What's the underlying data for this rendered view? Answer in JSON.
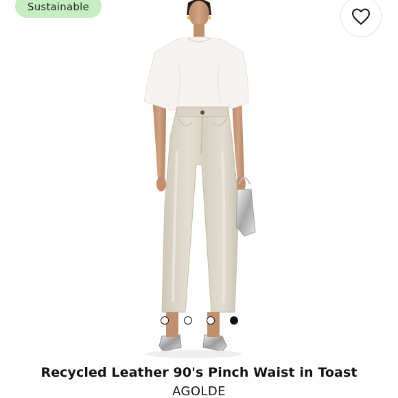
{
  "badge": {
    "label": "Sustainable",
    "color": "#c7eec3"
  },
  "favorite": {
    "icon": "heart-icon"
  },
  "image": {
    "subject": "model-wearing-white-tee-and-leather-pants",
    "pants_color": "#dcd6c8",
    "shirt_color": "#f6f4f1"
  },
  "carousel": {
    "total": 4,
    "active_index": 3
  },
  "product": {
    "title": "Recycled Leather 90's Pinch Waist in Toast",
    "brand": "AGOLDE"
  }
}
